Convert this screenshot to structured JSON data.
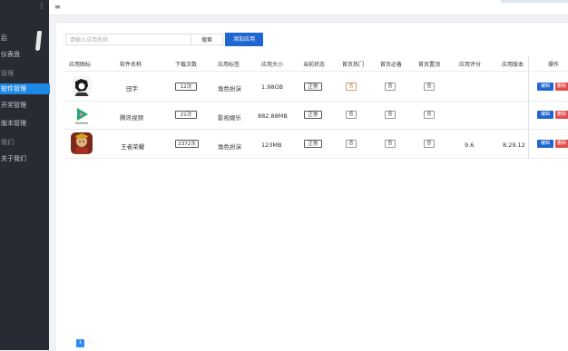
{
  "sidebar": {
    "menu_glyph": "⋮",
    "items": [
      {
        "label": "后",
        "kind": "item"
      },
      {
        "label": "仪表盘",
        "kind": "item"
      },
      {
        "label": "管理",
        "kind": "group"
      },
      {
        "label": "软件管理",
        "kind": "active"
      },
      {
        "label": "开奖管理",
        "kind": "item"
      },
      {
        "label": "版本管理",
        "kind": "item"
      },
      {
        "label": "我们",
        "kind": "group"
      },
      {
        "label": "关于我们",
        "kind": "item"
      }
    ]
  },
  "toolbar": {
    "menu_icon": "≡",
    "search_placeholder": "请输入应用名称",
    "search_label": "搜索",
    "add_label": "添加应用"
  },
  "table": {
    "headers": [
      "应用图标",
      "软件名称",
      "下载次数",
      "应用标签",
      "应用大小",
      "当前状态",
      "首页热门",
      "首页必备",
      "首页置顶",
      "应用评分",
      "应用版本",
      "操作"
    ],
    "rows": [
      {
        "name": "田字",
        "downloads": "12次",
        "tag": "角色扮演",
        "size": "1.98GB",
        "status": "正常",
        "hot": "否",
        "must": "否",
        "top": "否",
        "rating": "",
        "version": ""
      },
      {
        "name": "腾讯视频",
        "downloads": "21次",
        "tag": "影视娱乐",
        "size": "882.88MB",
        "status": "正常",
        "hot": "否",
        "must": "否",
        "top": "否",
        "rating": "",
        "version": ""
      },
      {
        "name": "王者荣耀",
        "downloads": "2372次",
        "tag": "角色扮演",
        "size": "123MB",
        "status": "正常",
        "hot": "否",
        "must": "否",
        "top": "否",
        "rating": "9.6",
        "version": "8.29.12"
      }
    ],
    "edit_label": "编辑",
    "delete_label": "删除"
  },
  "pagination": {
    "current": "1",
    "next": "›"
  },
  "colors": {
    "primary": "#1f66d1",
    "danger": "#e04d4d",
    "sidebar": "#282b33",
    "active": "#1e88e5"
  }
}
